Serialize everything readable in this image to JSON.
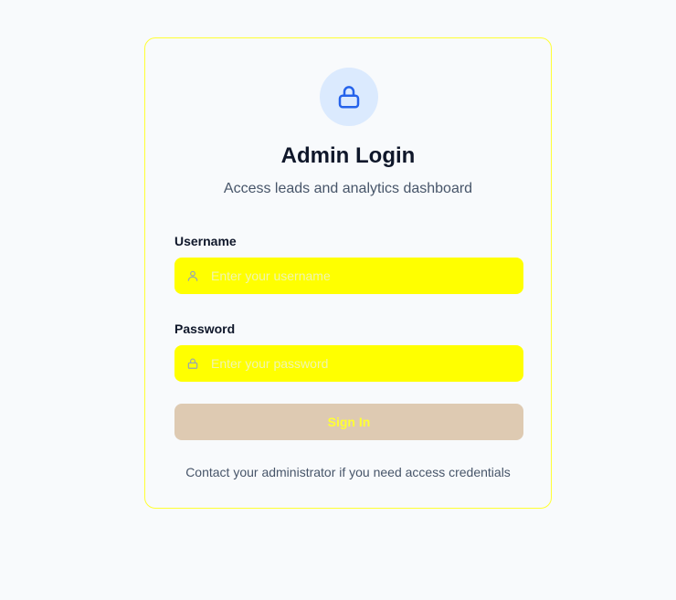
{
  "login": {
    "title": "Admin Login",
    "subtitle": "Access leads and analytics dashboard",
    "username_label": "Username",
    "username_placeholder": "Enter your username",
    "username_value": "",
    "username_icon": "user-icon",
    "password_label": "Password",
    "password_placeholder": "Enter your password",
    "password_value": "",
    "password_icon": "lock-icon",
    "signin_label": "Sign In",
    "footer_note": "Contact your administrator if you need access credentials",
    "header_icon": "lock-icon"
  },
  "colors": {
    "page_background": "#f8fafc",
    "card_border": "#ffff33",
    "icon_badge_background": "#dbeafe",
    "icon_accent": "#2563eb",
    "input_background": "#ffff00",
    "button_background": "#decab2",
    "button_text": "#ffff33",
    "title_text": "#0f172a",
    "muted_text": "#475569"
  }
}
